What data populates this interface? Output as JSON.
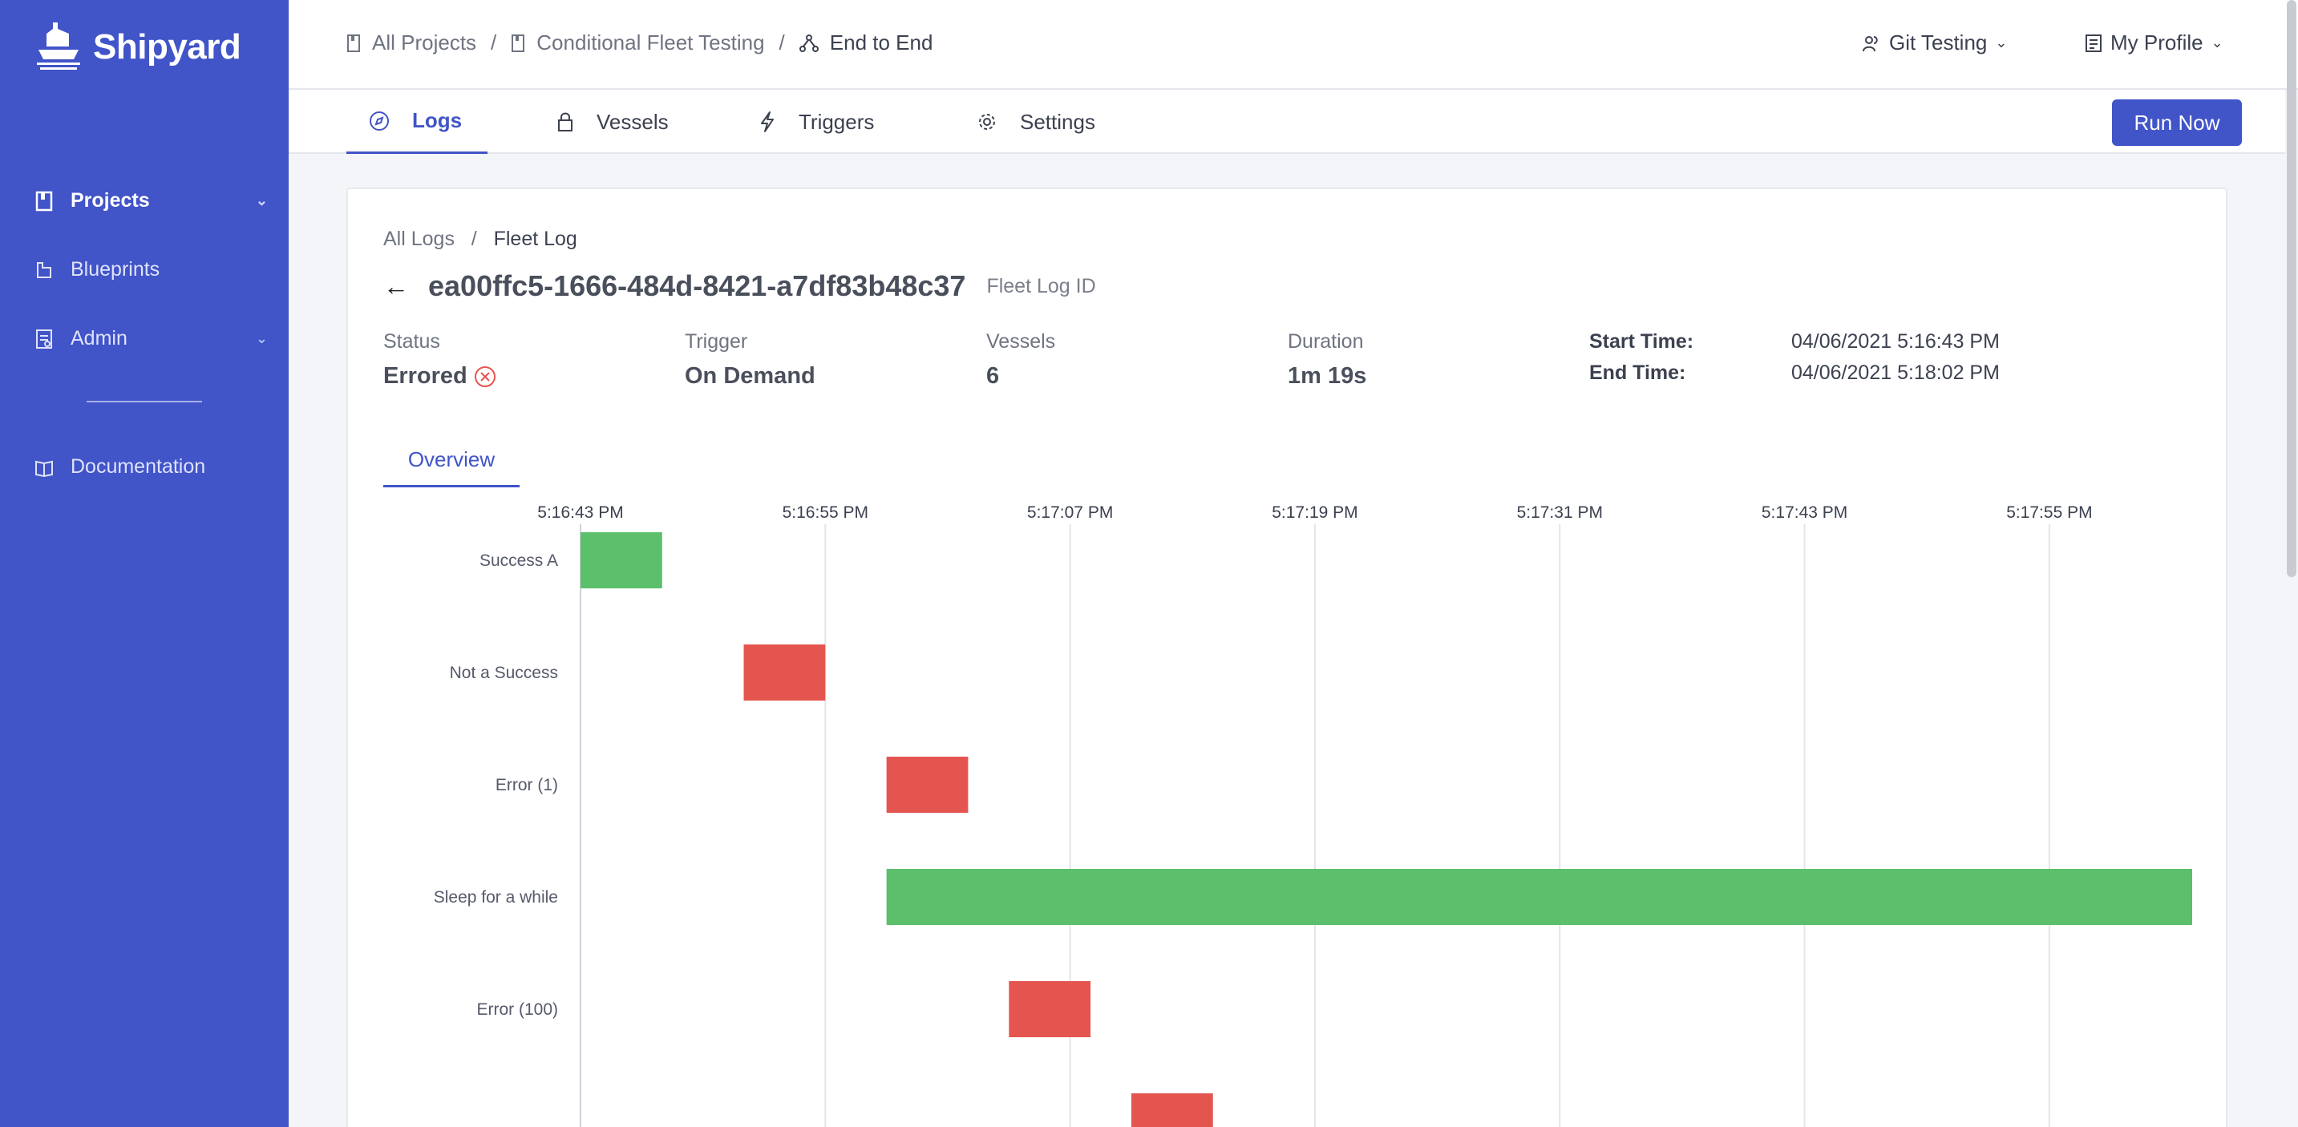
{
  "app": {
    "brand": "Shipyard",
    "brand_color": "#4154c8"
  },
  "sidebar": {
    "items": [
      {
        "label": "Projects",
        "icon": "book-icon",
        "active": true,
        "chevron": true
      },
      {
        "label": "Blueprints",
        "icon": "blueprint-icon",
        "active": false,
        "chevron": false
      },
      {
        "label": "Admin",
        "icon": "admin-icon",
        "active": false,
        "chevron": true
      },
      {
        "label": "Documentation",
        "icon": "docs-icon",
        "active": false,
        "chevron": false
      }
    ]
  },
  "header": {
    "breadcrumb": [
      "All Projects",
      "Conditional Fleet Testing",
      "End to End"
    ],
    "org_label": "Git Testing",
    "profile_label": "My Profile"
  },
  "tabs": [
    {
      "label": "Logs",
      "icon": "compass-icon",
      "active": true
    },
    {
      "label": "Vessels",
      "icon": "lock-icon",
      "active": false
    },
    {
      "label": "Triggers",
      "icon": "lightning-icon",
      "active": false
    },
    {
      "label": "Settings",
      "icon": "gear-icon",
      "active": false
    }
  ],
  "run_button": "Run Now",
  "log": {
    "breadcrumb": [
      "All Logs",
      "Fleet Log"
    ],
    "id": "ea00ffc5-1666-484d-8421-a7df83b48c37",
    "id_label": "Fleet Log ID",
    "status_label": "Status",
    "status": "Errored",
    "trigger_label": "Trigger",
    "trigger": "On Demand",
    "vessels_label": "Vessels",
    "vessels": "6",
    "duration_label": "Duration",
    "duration": "1m 19s",
    "start_label": "Start Time:",
    "start": "04/06/2021 5:16:43 PM",
    "end_label": "End Time:",
    "end": "04/06/2021 5:18:02 PM"
  },
  "subtab": "Overview",
  "chart_data": {
    "type": "gantt",
    "x_ticks": [
      "5:16:43 PM",
      "5:16:55 PM",
      "5:17:07 PM",
      "5:17:19 PM",
      "5:17:31 PM",
      "5:17:43 PM",
      "5:17:55 PM"
    ],
    "x_range_seconds": [
      0,
      79
    ],
    "colors": {
      "success": "#5bbf6b",
      "error": "#e5554f"
    },
    "rows": [
      {
        "label": "Success A",
        "start": 0,
        "end": 4,
        "status": "success"
      },
      {
        "label": "Not a Success",
        "start": 8,
        "end": 12,
        "status": "error"
      },
      {
        "label": "Error (1)",
        "start": 15,
        "end": 19,
        "status": "error"
      },
      {
        "label": "Sleep for a while",
        "start": 15,
        "end": 79,
        "status": "success"
      },
      {
        "label": "Error (100)",
        "start": 21,
        "end": 25,
        "status": "error"
      },
      {
        "label": "",
        "start": 27,
        "end": 31,
        "status": "error"
      }
    ]
  }
}
